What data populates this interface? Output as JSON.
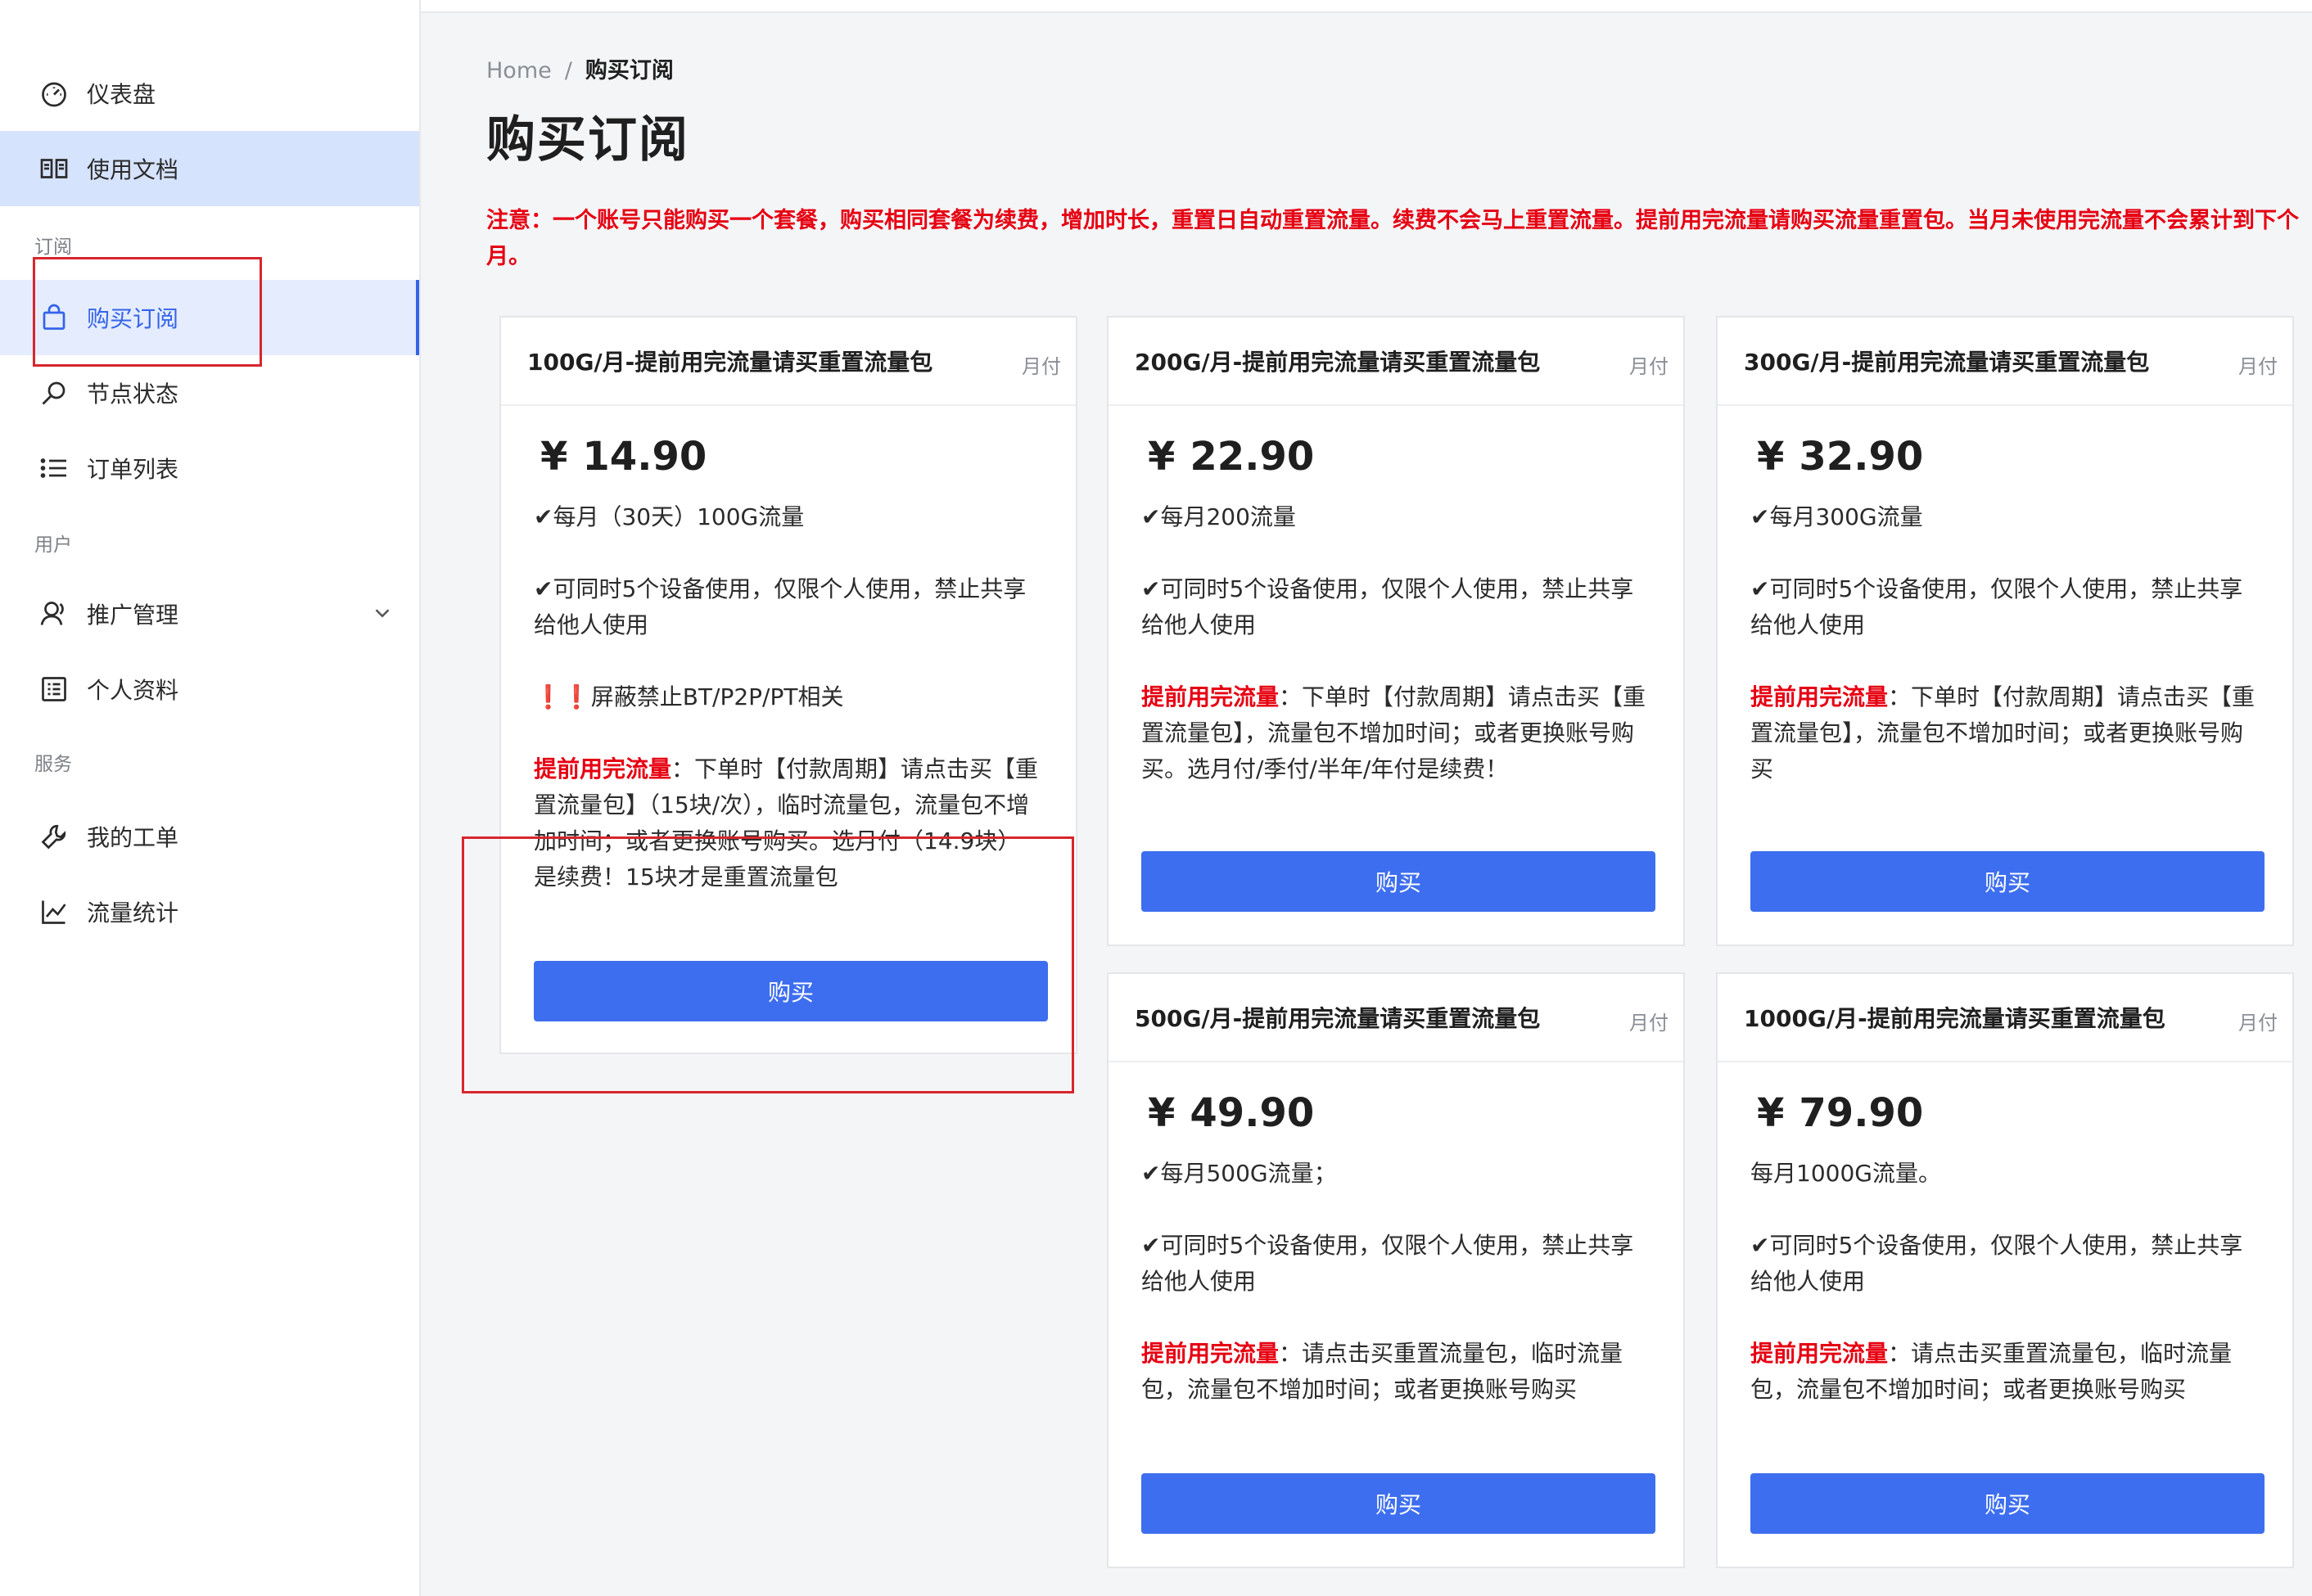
{
  "sidebar": {
    "items": [
      {
        "label": "仪表盘",
        "icon": "dashboard-icon"
      },
      {
        "label": "使用文档",
        "icon": "book-icon"
      },
      {
        "label": "购买订阅",
        "icon": "shopping-bag-icon"
      },
      {
        "label": "节点状态",
        "icon": "search-icon"
      },
      {
        "label": "订单列表",
        "icon": "list-icon"
      },
      {
        "label": "推广管理",
        "icon": "user-icon"
      },
      {
        "label": "个人资料",
        "icon": "profile-icon"
      },
      {
        "label": "我的工单",
        "icon": "wrench-icon"
      },
      {
        "label": "流量统计",
        "icon": "chart-icon"
      }
    ],
    "sections": [
      "订阅",
      "用户",
      "服务"
    ]
  },
  "breadcrumb": {
    "home": "Home",
    "sep": "/",
    "current": "购买订阅"
  },
  "page": {
    "title": "购买订阅",
    "notice": "注意：一个账号只能购买一个套餐，购买相同套餐为续费，增加时长，重置日自动重置流量。续费不会马上重置流量。提前用完流量请购买流量重置包。当月未使用完流量不会累计到下个月。"
  },
  "plans": [
    {
      "title": "100G/月-提前用完流量请买重置流量包",
      "period": "月付",
      "price": "14.90",
      "currency": "¥",
      "features": [
        {
          "text": "✔每月（30天）100G流量"
        },
        {
          "text": "✔可同时5个设备使用，仅限个人使用，禁止共享给他人使用"
        },
        {
          "text": "❗❗屏蔽禁止BT/P2P/PT相关"
        },
        {
          "red": "提前用完流量",
          "text": "：下单时【付款周期】请点击买【重置流量包】（15块/次），临时流量包，流量包不增加时间；或者更换账号购买。选月付（14.9块）是续费！15块才是重置流量包"
        }
      ],
      "button": "购买"
    },
    {
      "title": "200G/月-提前用完流量请买重置流量包",
      "period": "月付",
      "price": "22.90",
      "currency": "¥",
      "features": [
        {
          "text": "✔每月200流量"
        },
        {
          "text": "✔可同时5个设备使用，仅限个人使用，禁止共享给他人使用"
        },
        {
          "red": "提前用完流量",
          "text": "：下单时【付款周期】请点击买【重置流量包】，流量包不增加时间；或者更换账号购买。选月付/季付/半年/年付是续费！"
        }
      ],
      "button": "购买"
    },
    {
      "title": "300G/月-提前用完流量请买重置流量包",
      "period": "月付",
      "price": "32.90",
      "currency": "¥",
      "features": [
        {
          "text": "✔每月300G流量"
        },
        {
          "text": "✔可同时5个设备使用，仅限个人使用，禁止共享给他人使用"
        },
        {
          "red": "提前用完流量",
          "text": "：下单时【付款周期】请点击买【重置流量包】，流量包不增加时间；或者更换账号购买"
        }
      ],
      "button": "购买"
    },
    {
      "title": "500G/月-提前用完流量请买重置流量包",
      "period": "月付",
      "price": "49.90",
      "currency": "¥",
      "features": [
        {
          "text": "✔每月500G流量；"
        },
        {
          "text": "✔可同时5个设备使用，仅限个人使用，禁止共享给他人使用"
        },
        {
          "red": "提前用完流量",
          "text": "：请点击买重置流量包，临时流量包，流量包不增加时间；或者更换账号购买"
        }
      ],
      "button": "购买"
    },
    {
      "title": "1000G/月-提前用完流量请买重置流量包",
      "period": "月付",
      "price": "79.90",
      "currency": "¥",
      "features": [
        {
          "text": "每月1000G流量。"
        },
        {
          "text": "✔可同时5个设备使用，仅限个人使用，禁止共享给他人使用"
        },
        {
          "red": "提前用完流量",
          "text": "：请点击买重置流量包，临时流量包，流量包不增加时间；或者更换账号购买"
        }
      ],
      "button": "购买"
    }
  ],
  "colors": {
    "accent": "#3d6eef",
    "notice_red": "#e60012",
    "sidebar_highlight": "#d6e3fd",
    "annotation_red": "#d7262e"
  }
}
